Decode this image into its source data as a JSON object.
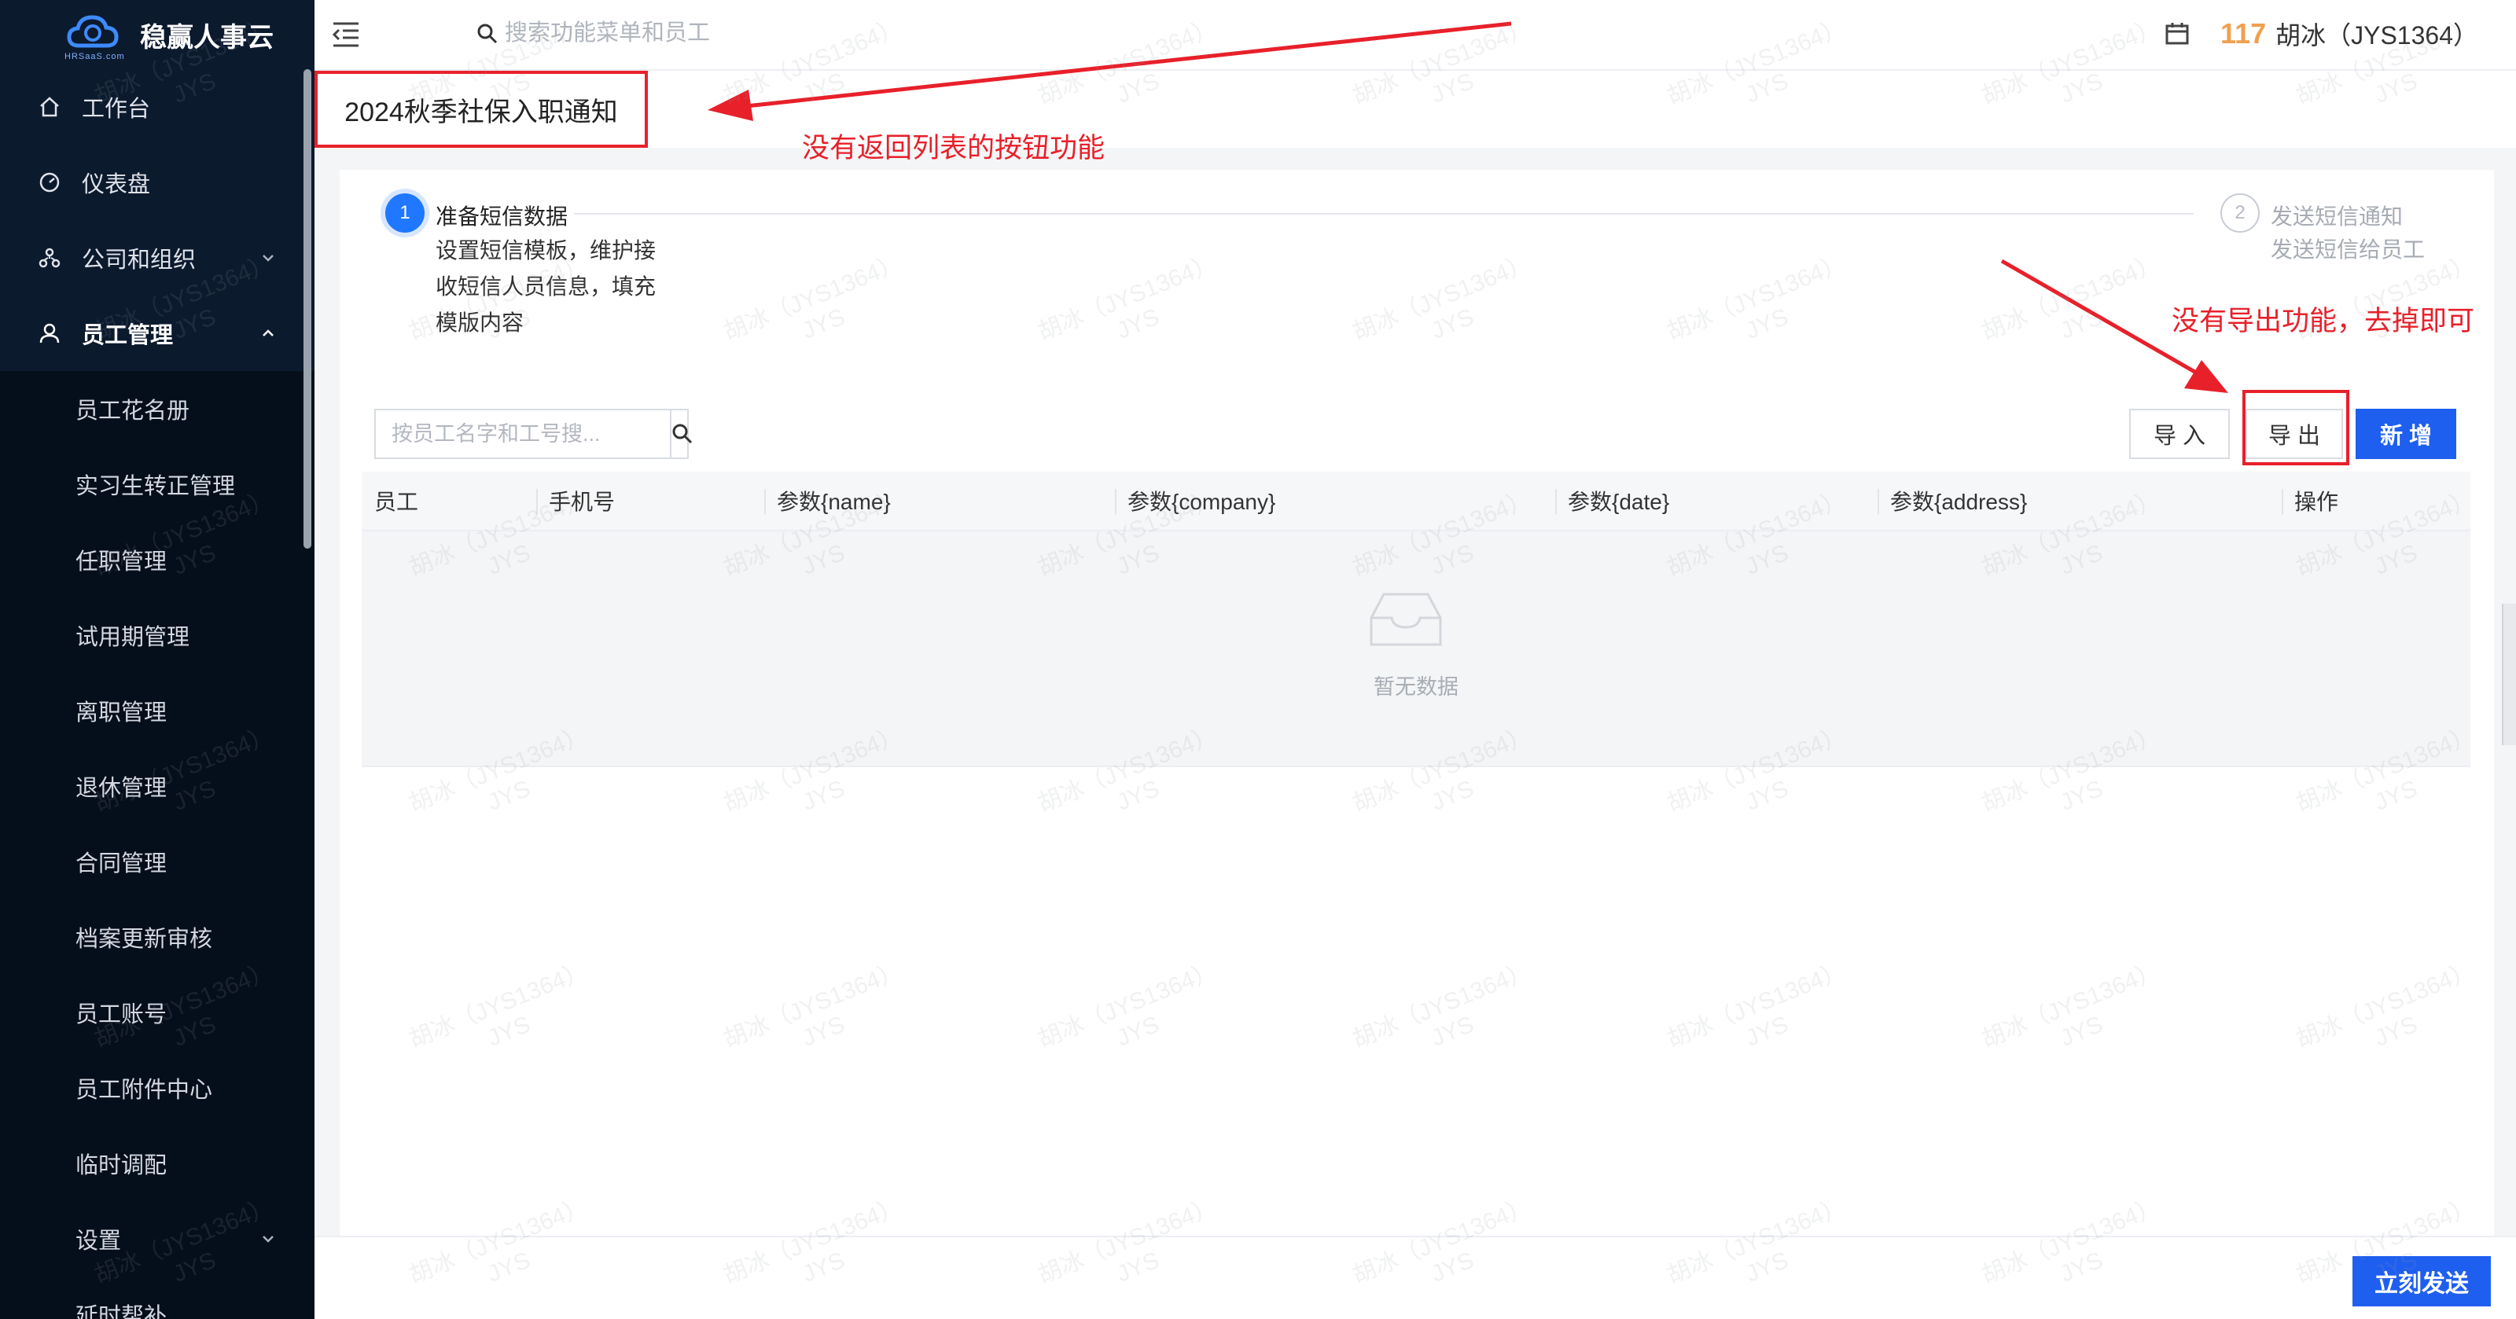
{
  "app": {
    "logo_text": "稳赢人事云",
    "logo_sub": "HRSaaS.com"
  },
  "sidebar": {
    "items": [
      {
        "label": "工作台",
        "icon": "home-icon"
      },
      {
        "label": "仪表盘",
        "icon": "dashboard-icon"
      },
      {
        "label": "公司和组织",
        "icon": "org-icon"
      },
      {
        "label": "员工管理",
        "icon": "user-icon"
      }
    ],
    "sub_items": [
      "员工花名册",
      "实习生转正管理",
      "任职管理",
      "试用期管理",
      "离职管理",
      "退休管理",
      "合同管理",
      "档案更新审核",
      "员工账号",
      "员工附件中心",
      "临时调配",
      "设置",
      "延时帮补"
    ]
  },
  "topbar": {
    "search_placeholder": "搜索功能菜单和员工",
    "points": "117",
    "user": "胡冰（JYS1364）"
  },
  "page": {
    "title": "2024秋季社保入职通知"
  },
  "steps": [
    {
      "num": "1",
      "title": "准备短信数据",
      "desc": "设置短信模板，维护接收短信人员信息，填充模版内容"
    },
    {
      "num": "2",
      "title": "发送短信通知",
      "desc": "发送短信给员工"
    }
  ],
  "toolbar": {
    "filter_placeholder": "按员工名字和工号搜...",
    "import_label": "导 入",
    "export_label": "导 出",
    "add_label": "新 增"
  },
  "table": {
    "columns": [
      "员工",
      "手机号",
      "参数{name}",
      "参数{company}",
      "参数{date}",
      "参数{address}",
      "操作"
    ],
    "empty_text": "暂无数据"
  },
  "footer": {
    "send_label": "立刻发送"
  },
  "annotations": {
    "note1": "没有返回列表的按钮功能",
    "note2": "没有导出功能，去掉即可"
  },
  "watermark": {
    "line1": "胡冰（JYS1364）",
    "line2": "JYS"
  },
  "colors": {
    "primary": "#1f5ff0",
    "sidebar_bg": "#0c1a2e",
    "annotation_red": "#e8202a",
    "points": "#f0a050"
  }
}
